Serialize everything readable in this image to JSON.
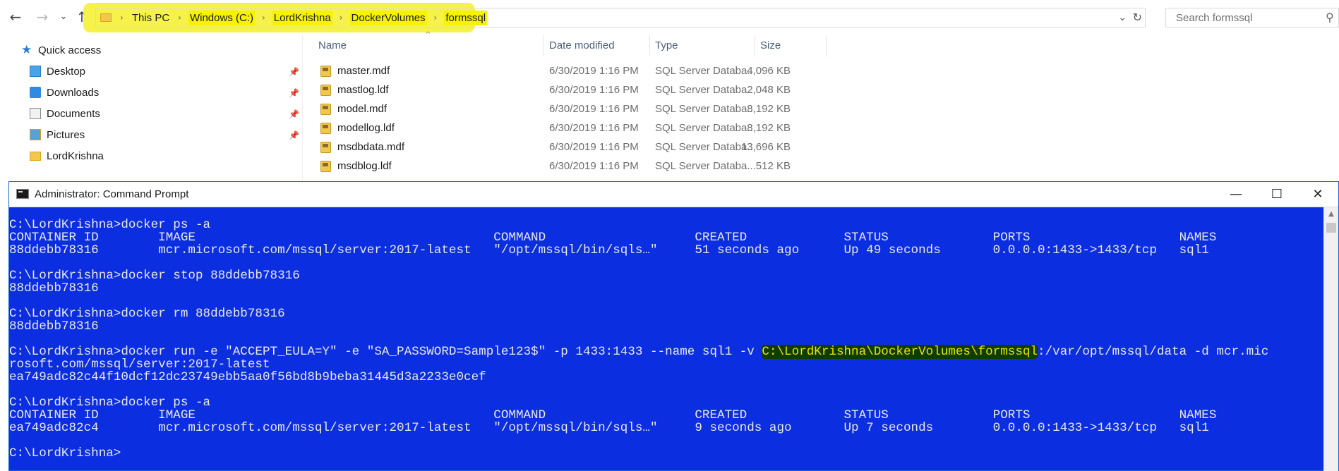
{
  "explorer": {
    "breadcrumbs": [
      "This PC",
      "Windows (C:)",
      "LordKrishna",
      "DockerVolumes",
      "formssql"
    ],
    "search_placeholder": "Search formssql",
    "nav_buttons": {
      "back": "←",
      "forward": "→",
      "up": "↑",
      "recent": "⌄"
    },
    "nav_pane": {
      "quick_access": "Quick access",
      "items": [
        {
          "label": "Desktop",
          "pinned": true,
          "icon": "desktop-icon"
        },
        {
          "label": "Downloads",
          "pinned": true,
          "icon": "downloads-icon"
        },
        {
          "label": "Documents",
          "pinned": true,
          "icon": "documents-icon"
        },
        {
          "label": "Pictures",
          "pinned": true,
          "icon": "pictures-icon"
        },
        {
          "label": "LordKrishna",
          "pinned": false,
          "icon": "folder-icon"
        }
      ]
    },
    "columns": {
      "name": "Name",
      "date": "Date modified",
      "type": "Type",
      "size": "Size"
    },
    "files": [
      {
        "name": "master.mdf",
        "date": "6/30/2019 1:16 PM",
        "type": "SQL Server Databa...",
        "size": "4,096 KB"
      },
      {
        "name": "mastlog.ldf",
        "date": "6/30/2019 1:16 PM",
        "type": "SQL Server Databa...",
        "size": "2,048 KB"
      },
      {
        "name": "model.mdf",
        "date": "6/30/2019 1:16 PM",
        "type": "SQL Server Databa...",
        "size": "8,192 KB"
      },
      {
        "name": "modellog.ldf",
        "date": "6/30/2019 1:16 PM",
        "type": "SQL Server Databa...",
        "size": "8,192 KB"
      },
      {
        "name": "msdbdata.mdf",
        "date": "6/30/2019 1:16 PM",
        "type": "SQL Server Databa...",
        "size": "13,696 KB"
      },
      {
        "name": "msdblog.ldf",
        "date": "6/30/2019 1:16 PM",
        "type": "SQL Server Databa...",
        "size": "512 KB"
      }
    ],
    "highlight_color": "#f6f200"
  },
  "cmd": {
    "title": "Administrator: Command Prompt",
    "background": "#0b2fe0",
    "lines": {
      "l01": "C:\\LordKrishna>docker ps -a",
      "l02": "CONTAINER ID        IMAGE                                        COMMAND                    CREATED             STATUS              PORTS                    NAMES",
      "l03": "88ddebb78316        mcr.microsoft.com/mssql/server:2017-latest   \"/opt/mssql/bin/sqls…\"     51 seconds ago      Up 49 seconds       0.0.0.0:1433->1433/tcp   sql1",
      "l04": "",
      "l05": "C:\\LordKrishna>docker stop 88ddebb78316",
      "l06": "88ddebb78316",
      "l07": "",
      "l08": "C:\\LordKrishna>docker rm 88ddebb78316",
      "l09": "88ddebb78316",
      "l10": "",
      "l11_pre": "C:\\LordKrishna>docker run -e \"ACCEPT_EULA=Y\" -e \"SA_PASSWORD=Sample123$\" -p 1433:1433 --name sql1 -v ",
      "l11_hl": "C:\\LordKrishna\\DockerVolumes\\formssql",
      "l11_post": ":/var/opt/mssql/data -d mcr.mic",
      "l12": "rosoft.com/mssql/server:2017-latest",
      "l13": "ea749adc82c44f10dcf12dc23749ebb5aa0f56bd8b9beba31445d3a2233e0cef",
      "l14": "",
      "l15": "C:\\LordKrishna>docker ps -a",
      "l16": "CONTAINER ID        IMAGE                                        COMMAND                    CREATED             STATUS              PORTS                    NAMES",
      "l17": "ea749adc82c4        mcr.microsoft.com/mssql/server:2017-latest   \"/opt/mssql/bin/sqls…\"     9 seconds ago       Up 7 seconds        0.0.0.0:1433->1433/tcp   sql1",
      "l18": "",
      "l19": "C:\\LordKrishna>"
    }
  }
}
